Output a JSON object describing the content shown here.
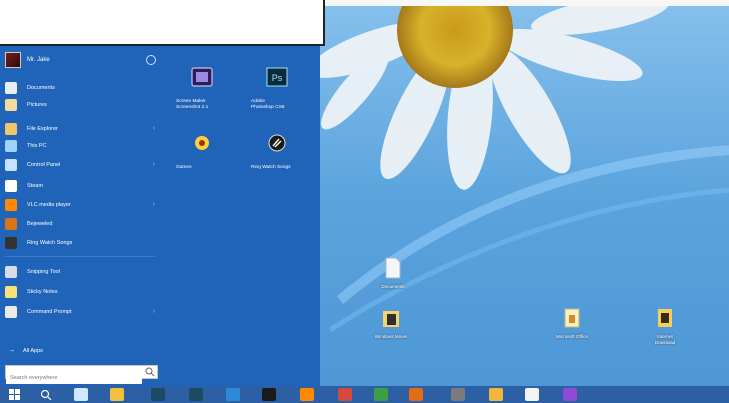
{
  "start_menu": {
    "user_name": "Mr. Jake",
    "items": [
      {
        "label": "Documents",
        "icon": "documents-icon",
        "color": "#e9edf5",
        "has_arrow": false
      },
      {
        "label": "Pictures",
        "icon": "pictures-icon",
        "color": "#f4d9a1",
        "has_arrow": false
      },
      {
        "label": "File Explorer",
        "icon": "file-explorer-icon",
        "color": "#f1c66a",
        "has_arrow": true
      },
      {
        "label": "This PC",
        "icon": "this-pc-icon",
        "color": "#9fd2ff",
        "has_arrow": false
      },
      {
        "label": "Control Panel",
        "icon": "control-panel-icon",
        "color": "#c7e3ff",
        "has_arrow": true
      },
      {
        "label": "Steam",
        "icon": "steam-icon",
        "color": "#ffffff",
        "has_arrow": false
      },
      {
        "label": "VLC media player",
        "icon": "vlc-icon",
        "color": "#ff8a00",
        "has_arrow": true
      },
      {
        "label": "Bejeweled",
        "icon": "bejeweled-icon",
        "color": "#d9741b",
        "has_arrow": false
      },
      {
        "label": "Ring Watch Songs",
        "icon": "ring-watch-icon",
        "color": "#333333",
        "has_arrow": false
      },
      {
        "label": "Snipping Tool",
        "icon": "snipping-tool-icon",
        "color": "#d6dde9",
        "has_arrow": false
      },
      {
        "label": "Sticky Notes",
        "icon": "sticky-notes-icon",
        "color": "#f7e27a",
        "has_arrow": false
      },
      {
        "label": "Command Prompt",
        "icon": "command-prompt-icon",
        "color": "#eaeaea",
        "has_arrow": true
      }
    ],
    "all_apps": "All Apps",
    "search_placeholder": "Search everywhere"
  },
  "tiles": [
    {
      "label": "Screen Maker",
      "sublabel": "Screenshot 2.1",
      "color": "#6a3da8",
      "icon": "screen-maker-icon"
    },
    {
      "label": "Adobe",
      "sublabel": "Photoshop CS6",
      "color": "#1ea3a9",
      "icon": "photoshop-icon"
    },
    {
      "label": "Games",
      "sublabel": "",
      "color": "#ea5b1f",
      "icon": "games-icon"
    },
    {
      "label": "Ring Watch Songs",
      "sublabel": "",
      "color": "#666666",
      "icon": "ring-watch-tile-icon"
    }
  ],
  "desktop_icons": [
    {
      "label": "Documents",
      "icon": "document-file-icon"
    },
    {
      "label": "Windows Movie",
      "icon": "movie-folder-icon"
    },
    {
      "label": "Microsoft Office",
      "icon": "office-folder-icon"
    },
    {
      "label": "Internet Download",
      "icon": "download-folder-icon"
    }
  ],
  "taskbar": {
    "items": [
      "start-icon",
      "search-icon",
      "task-view-icon",
      "chrome-icon",
      "photoshop-icon",
      "photoshop-icon",
      "explorer-icon",
      "steam-icon",
      "vlc-icon",
      "paint-icon",
      "steam-green-icon",
      "firefox-icon",
      "tools-icon",
      "yellow-app-icon",
      "notepad-icon",
      "purple-app-icon"
    ]
  },
  "colors": {
    "start_bg": "#1f64b8",
    "taskbar_bg": "#2c5fa3",
    "desktop_sky": "#6aaee2"
  }
}
